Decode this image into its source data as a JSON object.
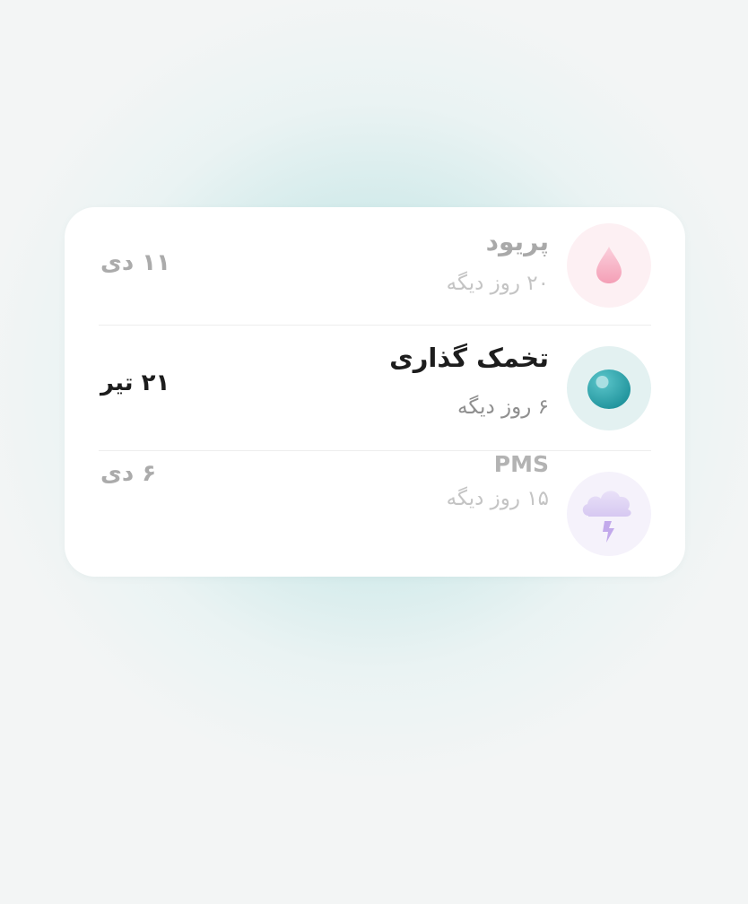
{
  "events": [
    {
      "title": "پریود",
      "remaining": "۲۰ روز دیگه",
      "date": "۱۱ دی",
      "icon": "drop-icon",
      "color": "#f7b9cb"
    },
    {
      "title": "تخمک گذاری",
      "remaining": "۶ روز دیگه",
      "date": "۲۱ تیر",
      "icon": "egg-icon",
      "color": "#2fa6ad"
    },
    {
      "title": "PMS",
      "remaining": "۱۵ روز دیگه",
      "date": "۶ دی",
      "icon": "storm-cloud-icon",
      "color": "#c9b4ea"
    }
  ]
}
